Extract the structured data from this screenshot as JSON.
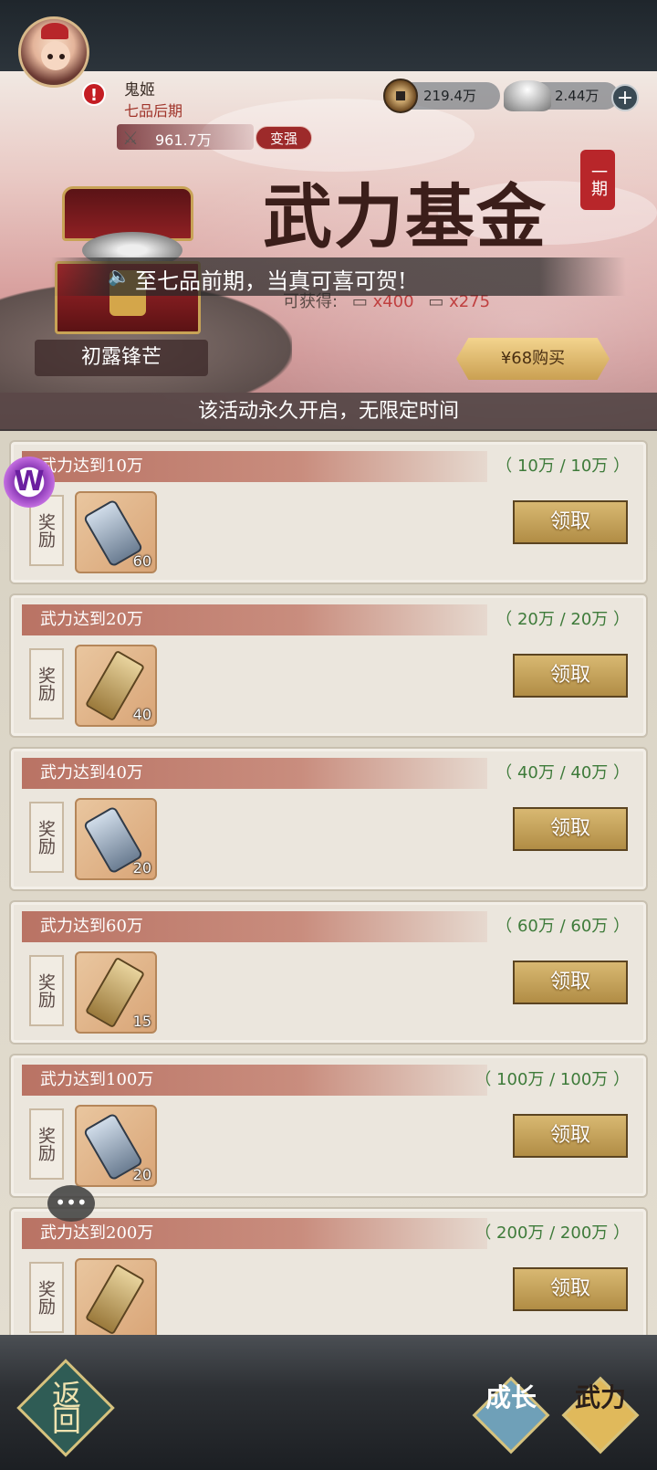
{
  "player": {
    "name": "鬼姬",
    "rank": "七品后期",
    "power": "961.7万",
    "strengthen_label": "变强"
  },
  "currency": {
    "coins": "219.4万",
    "ingots": "2.44万",
    "add_icon": "plus-icon"
  },
  "banner": {
    "title": "武力基金",
    "period": "一期",
    "marquee": "至七品前期，当真可喜可贺!",
    "obtain_label": "可获得:",
    "obtain_item1": "x400",
    "obtain_item2": "x275",
    "chest_name": "初露锋芒",
    "buy_label": "¥68购买",
    "notice": "该活动永久开启，无限定时间"
  },
  "rewards": [
    {
      "condition": "武力达到10万",
      "progress": "（ 10万 / 10万 ）",
      "reward_label": "奖励",
      "item": "blue-scroll",
      "count": "60",
      "claim": "领取"
    },
    {
      "condition": "武力达到20万",
      "progress": "（ 20万 / 20万 ）",
      "reward_label": "奖励",
      "item": "gold-scroll",
      "count": "40",
      "claim": "领取"
    },
    {
      "condition": "武力达到40万",
      "progress": "（ 40万 / 40万 ）",
      "reward_label": "奖励",
      "item": "blue-scroll",
      "count": "20",
      "claim": "领取"
    },
    {
      "condition": "武力达到60万",
      "progress": "（ 60万 / 60万 ）",
      "reward_label": "奖励",
      "item": "gold-scroll",
      "count": "15",
      "claim": "领取"
    },
    {
      "condition": "武力达到100万",
      "progress": "（ 100万 / 100万 ）",
      "reward_label": "奖励",
      "item": "blue-scroll",
      "count": "20",
      "claim": "领取"
    },
    {
      "condition": "武力达到200万",
      "progress": "（ 200万 / 200万 ）",
      "reward_label": "奖励",
      "item": "gold-scroll",
      "count": "",
      "claim": "领取"
    }
  ],
  "nav": {
    "back_label": "返回",
    "tab_grow": "成长",
    "tab_power": "武力"
  },
  "colors": {
    "progress_green": "#3e7b3a",
    "condition_band": "#b97364",
    "claim_gold": "#c9a65a",
    "alert_red": "#c41d23"
  }
}
